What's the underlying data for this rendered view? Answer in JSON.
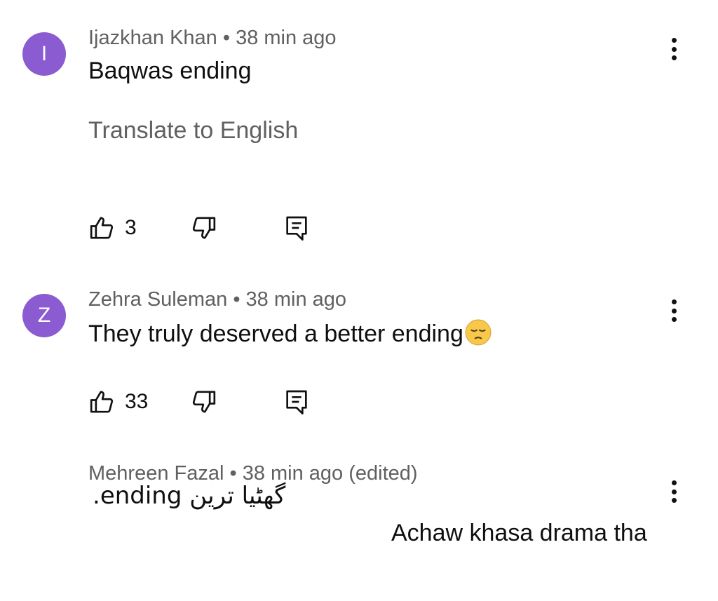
{
  "comments": [
    {
      "avatar_letter": "I",
      "author": "Ijazkhan Khan",
      "meta_time": " • 38 min ago",
      "text": "Baqwas ending",
      "translate_label": "Translate to English",
      "likes": "3"
    },
    {
      "avatar_letter": "Z",
      "author": "Zehra Suleman",
      "meta_time": " • 38 min ago",
      "text": "They truly deserved a better ending",
      "emoji": "pensive-face-emoji",
      "likes": "33"
    },
    {
      "author": "Mehreen Fazal",
      "meta_time": " • 38 min ago (edited)",
      "text_line1": "گھٹیا ترین ending.",
      "text_line2": "Achaw khasa drama tha"
    }
  ],
  "colors": {
    "avatar": "#8a5bd1",
    "meta": "#606060",
    "text": "#0f0f0f"
  },
  "icons": [
    "thumb-up-icon",
    "thumb-down-icon",
    "reply-icon",
    "more-vert-icon"
  ]
}
